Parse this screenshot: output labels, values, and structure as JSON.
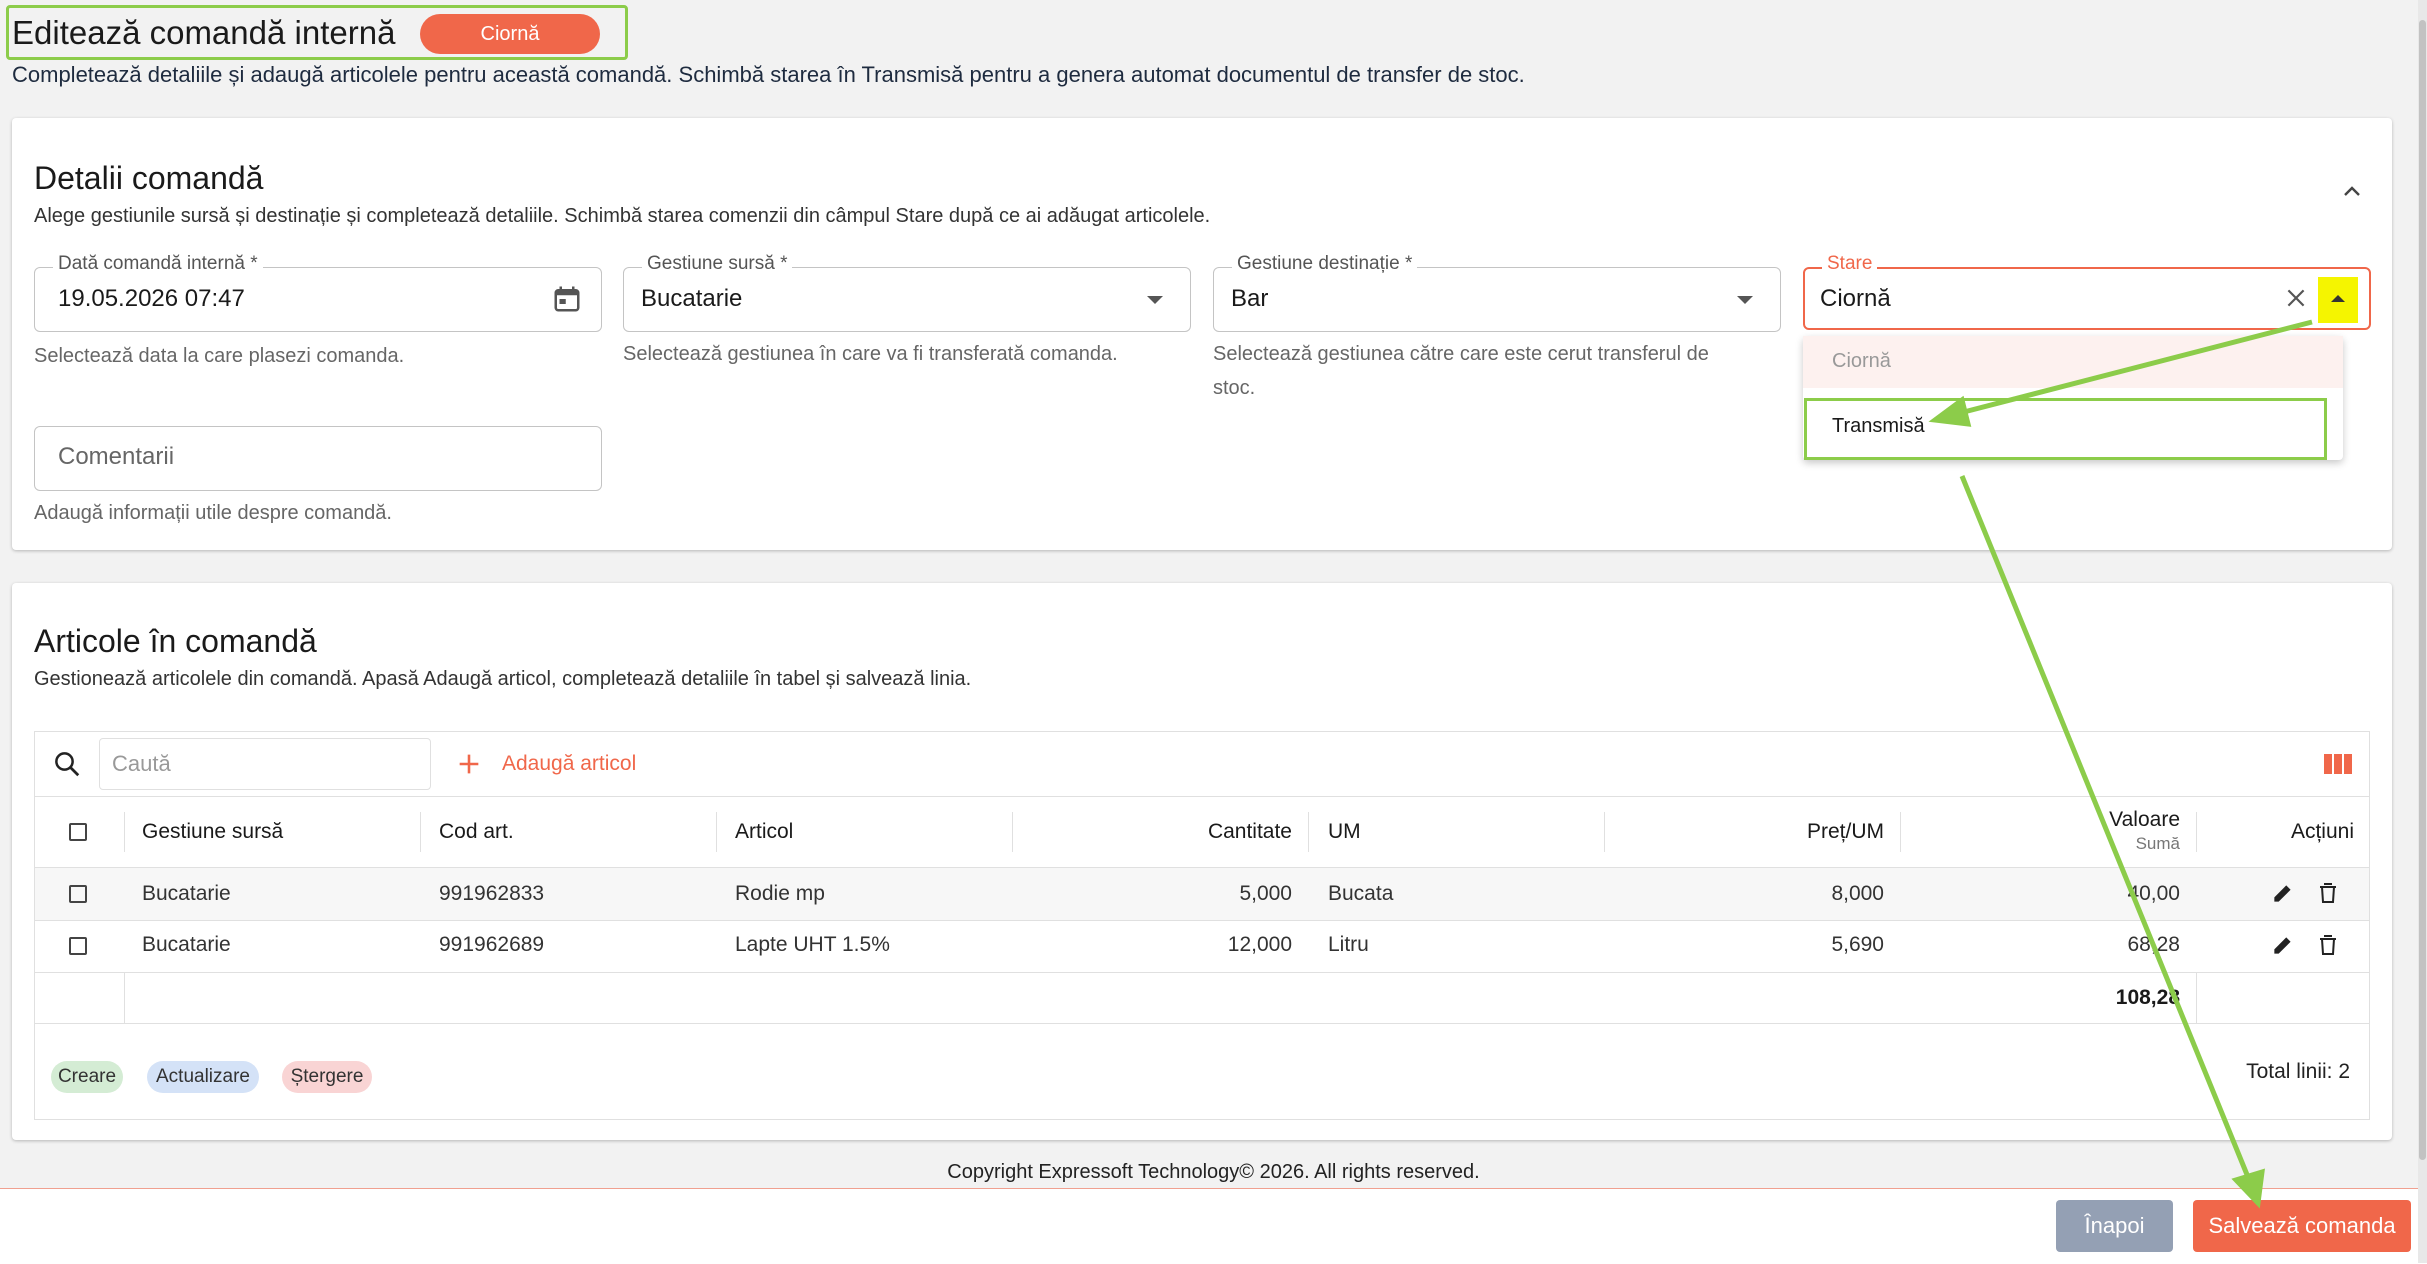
{
  "header": {
    "title": "Editează comandă internă",
    "status_badge": "Ciornă",
    "subtitle": "Completează detaliile și adaugă articolele pentru această comandă. Schimbă starea în Transmisă pentru a genera automat documentul de transfer de stoc."
  },
  "details": {
    "title": "Detalii comandă",
    "subtitle": "Alege gestiunile sursă și destinație și completează detaliile. Schimbă starea comenzii din câmpul Stare după ce ai adăugat articolele.",
    "date_field": {
      "label": "Dată comandă internă *",
      "value": "19.05.2026 07:47",
      "helper": "Selectează data la care plasezi comanda."
    },
    "source_field": {
      "label": "Gestiune sursă *",
      "value": "Bucatarie",
      "helper": "Selectează gestiunea în care va fi transferată comanda."
    },
    "dest_field": {
      "label": "Gestiune destinație *",
      "value": "Bar",
      "helper_line1": "Selectează gestiunea către care este cerut transferul de",
      "helper_line2": "stoc."
    },
    "status_field": {
      "label": "Stare",
      "value": "Ciornă",
      "options": [
        "Ciornă",
        "Transmisă"
      ]
    },
    "comments_field": {
      "placeholder": "Comentarii",
      "helper": "Adaugă informații utile despre comandă."
    }
  },
  "articles": {
    "title": "Articole în comandă",
    "subtitle": "Gestionează articolele din comandă. Apasă Adaugă articol, completează detaliile în tabel și salvează linia.",
    "search_placeholder": "Caută",
    "add_button": "Adaugă articol",
    "columns": {
      "source": "Gestiune sursă",
      "code": "Cod art.",
      "article": "Articol",
      "qty": "Cantitate",
      "um": "UM",
      "price": "Preț/UM",
      "value": "Valoare",
      "value_sub": "Sumă",
      "actions": "Acțiuni"
    },
    "rows": [
      {
        "source": "Bucatarie",
        "code": "991962833",
        "article": "Rodie mp",
        "qty": "5,000",
        "um": "Bucata",
        "price": "8,000",
        "value": "40,00"
      },
      {
        "source": "Bucatarie",
        "code": "991962689",
        "article": "Lapte UHT 1.5%",
        "qty": "12,000",
        "um": "Litru",
        "price": "5,690",
        "value": "68,28"
      }
    ],
    "total_value": "108,28",
    "legend": {
      "create": "Creare",
      "update": "Actualizare",
      "delete": "Ștergere"
    },
    "total_rows": "Total linii: 2"
  },
  "footer": {
    "copyright": "Copyright Expressoft Technology© 2026. All rights reserved.",
    "back_button": "Înapoi",
    "save_button": "Salvează comanda"
  },
  "colors": {
    "accent": "#f0674a",
    "highlight_green": "#8ccc4a",
    "highlight_yellow": "#f5f500",
    "chip_create": "#d4ecd4",
    "chip_update": "#d4e2f7",
    "chip_delete": "#f9d4d4",
    "back_button": "#94a0b4"
  },
  "icons": [
    "calendar-icon",
    "caret-down-icon",
    "clear-icon",
    "caret-up-icon",
    "search-icon",
    "plus-icon",
    "columns-icon",
    "edit-icon",
    "delete-icon",
    "collapse-chevron-icon"
  ]
}
